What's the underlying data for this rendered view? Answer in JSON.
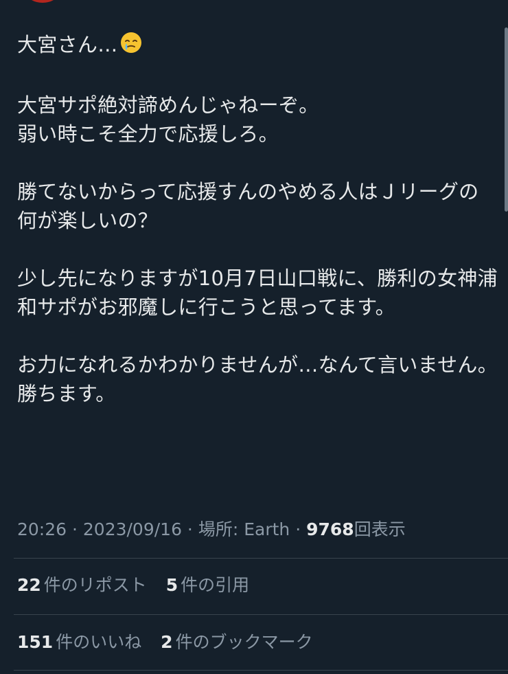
{
  "tweet": {
    "line_greeting": "大宮さん…",
    "emoji": "face-holding-back-tears",
    "paragraphs": [
      "大宮サポ絶対諦めんじゃねーぞ。\n弱い時こそ全力で応援しろ。",
      "勝てないからって応援すんのやめる人はＪリーグの何が楽しいの？",
      "少し先になりますが10月7日山口戦に、勝利の女神浦和サポがお邪魔しに行こうと思ってます。",
      "お力になれるかわかりませんが…なんて言いません。勝ちます。"
    ]
  },
  "meta": {
    "time": "20:26",
    "separator": " · ",
    "date": "2023/09/16",
    "location": "場所: Earth",
    "views_count": "9768",
    "views_label": "回表示"
  },
  "stats": {
    "reposts_count": "22",
    "reposts_label": "件のリポスト",
    "quotes_count": "5",
    "quotes_label": "件の引用",
    "likes_count": "151",
    "likes_label": "件のいいね",
    "bookmarks_count": "2",
    "bookmarks_label": "件のブックマーク"
  },
  "colors": {
    "background": "#15202b",
    "text": "#e7e9ea",
    "secondary": "#8b98a5",
    "divider": "#38444d"
  }
}
